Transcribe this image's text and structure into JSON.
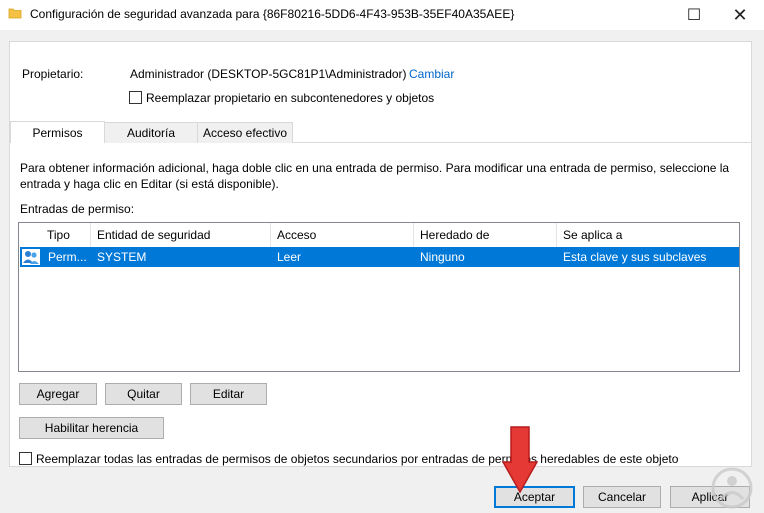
{
  "window": {
    "title": "Configuración de seguridad avanzada para {86F80216-5DD6-4F43-953B-35EF40A35AEE}",
    "maximize_glyph": "☐",
    "close_glyph": "✕"
  },
  "owner": {
    "label": "Propietario:",
    "value": "Administrador (DESKTOP-5GC81P1\\Administrador)",
    "change_link": "Cambiar",
    "replace_owner_checkbox": "Reemplazar propietario en subcontenedores y objetos"
  },
  "tabs": [
    {
      "label": "Permisos",
      "active": true
    },
    {
      "label": "Auditoría",
      "active": false
    },
    {
      "label": "Acceso efectivo",
      "active": false
    }
  ],
  "info_text": "Para obtener información adicional, haga doble clic en una entrada de permiso. Para modificar una entrada de permiso, seleccione la entrada y haga clic en Editar (si está disponible).",
  "entries_label": "Entradas de permiso:",
  "table": {
    "headers": [
      "Tipo",
      "Entidad de seguridad",
      "Acceso",
      "Heredado de",
      "Se aplica a"
    ],
    "rows": [
      [
        "Perm...",
        "SYSTEM",
        "Leer",
        "Ninguno",
        "Esta clave y sus subclaves"
      ]
    ]
  },
  "buttons": {
    "add": "Agregar",
    "remove": "Quitar",
    "edit": "Editar",
    "enable_inheritance": "Habilitar herencia",
    "ok": "Aceptar",
    "cancel": "Cancelar",
    "apply": "Aplicar"
  },
  "replace_all_checkbox": "Reemplazar todas las entradas de permisos de objetos secundarios por entradas de permisos heredables de este objeto",
  "icons": {
    "folder": "folder-icon",
    "users": "users-icon",
    "arrow": "red-arrow-down-icon",
    "watermark": "logo-icon"
  },
  "colors": {
    "selection": "#0078d7",
    "link": "#0066cc",
    "arrow": "#e53935"
  }
}
